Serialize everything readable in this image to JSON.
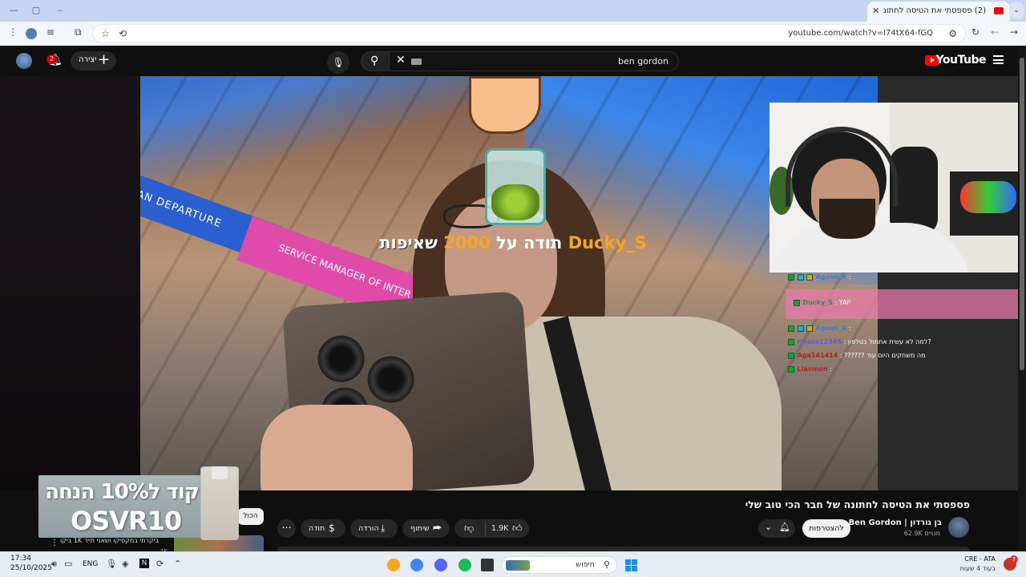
{
  "browser": {
    "tab_title": "(2) פספסתי את הטיסה לחתונה",
    "url": "youtube.com/watch?v=I74tX64-fGQ"
  },
  "youtube": {
    "search_query": "ben gordon",
    "logo_text": "YouTube",
    "create_label": "יצירה",
    "notification_count": "2"
  },
  "overlay": {
    "donation_name": "Ducky_S",
    "donation_middle": "תודה על",
    "donation_amount": "2000",
    "donation_suffix": "שאיפות",
    "sign_departure": "IAN DEPARTURE",
    "sign_service": "SERVICE MANAGER OF INTER"
  },
  "chat": [
    {
      "name": "Agami_X",
      "msg": ":",
      "color": "#3a7bd5"
    },
    {
      "name": "Ducky_S",
      "msg": ": YAP",
      "color": "#2e8b57"
    },
    {
      "name": "Agami_X",
      "msg": ":",
      "color": "#3a7bd5"
    },
    {
      "name": "Hilaze12345",
      "msg": ": למה לא עשית אתמול בטלפון?",
      "color": "#6a5acd"
    },
    {
      "name": "Aga141414",
      "msg": ": ?????? מה משחקים היום עוד",
      "color": "#b22222"
    },
    {
      "name": "Liavmon",
      "msg": ":",
      "color": "#b22222"
    }
  ],
  "video": {
    "title": "פספסתי את הטיסה לחתונה של חבר הכי טוב שלי",
    "channel": "Ben Gordon | בן גורדון",
    "subscribers": "62.9K מנויים",
    "subscribe_label": "להצטרפות",
    "likes": "1.9K",
    "share_label": "שיתוף",
    "download_label": "הורדה",
    "thanks_label": "תודה",
    "all_chip": "הכול"
  },
  "promo": {
    "line1": "קוד ל10% הנחה",
    "line2": "OSVR10"
  },
  "sidebar": {
    "next_text": "ביקרתי במקסיקו ושאני תייר 1K ביקו",
    "next_count": "1K"
  },
  "taskbar": {
    "time": "17:34",
    "date": "25/10/2025",
    "lang": "ENG",
    "search_placeholder": "חיפוש",
    "weather_line1": "CRE - ATA",
    "weather_line2": "בעוד 4 שעות",
    "weather_badge": "7"
  },
  "colors": {
    "yt_red": "#ff0000",
    "donation_gold": "#f5a623",
    "chat_highlight": "#e878aa"
  }
}
